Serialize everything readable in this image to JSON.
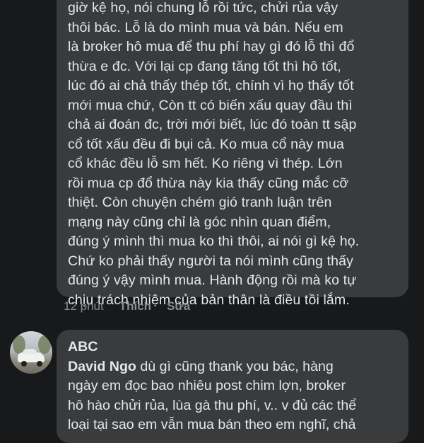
{
  "comment1": {
    "text": "giờ kệ họ, nói chung lỗ rồi tức, chửi rủa vậy\nthôi bác. Lỗ là do mình  mua và bán.  Nếu em\nlà broker hô mua để thu phí hay gì đó lỗ thì đổ\nthừa e đc. Với lại cp đang tăng tốt thì hô tốt,\nlúc đó ai chả thấy thép tốt, chính vì họ thấy tốt\nmới mua chứ, Còn tt có biến xấu quay đầu thì\nchả ai đoán đc, trời mới biết, lúc đó toàn tt sập\ncổ tốt xấu đều đi bụi cả. Ko mua cổ này mua\ncổ khác đều lỗ sm hết. Ko riêng vì thép. Lớn\nrồi mua cp đổ thừa này kia thấy cũng mắc cỡ\nthiệt. Còn chuyện chém gió tranh luận trên\nmạng này cũng chỉ là góc nhìn quan điểm,\nđúng ý mình thì mua ko thì thôi, ai nói gì kệ họ.\nChứ ko phải thấy người ta nói mình cũng thấy\nđúng ý vậy mình mua. Hành động rồi mà ko tự\nchịu trách nhiệm của bản thân là điều tồi lắm.",
    "time": "12 phút",
    "like_label": "Thích",
    "edit_label": "Sửa"
  },
  "comment2": {
    "author": "ABC",
    "mention": "David Ngo",
    "text": " dù gì cũng thank you bác, hàng\nngày em đọc bao nhiêu post chim lợn, broker\nhô hào chửi rủa, lùa gà thu phí, v.. v đủ các thể\nloại tại sao em vẫn mua bán theo em nghĩ, chả"
  },
  "colors": {
    "background": "#18191a",
    "bubble": "#3a3b3c",
    "text": "#e4e6eb",
    "meta": "#8a8d91"
  }
}
